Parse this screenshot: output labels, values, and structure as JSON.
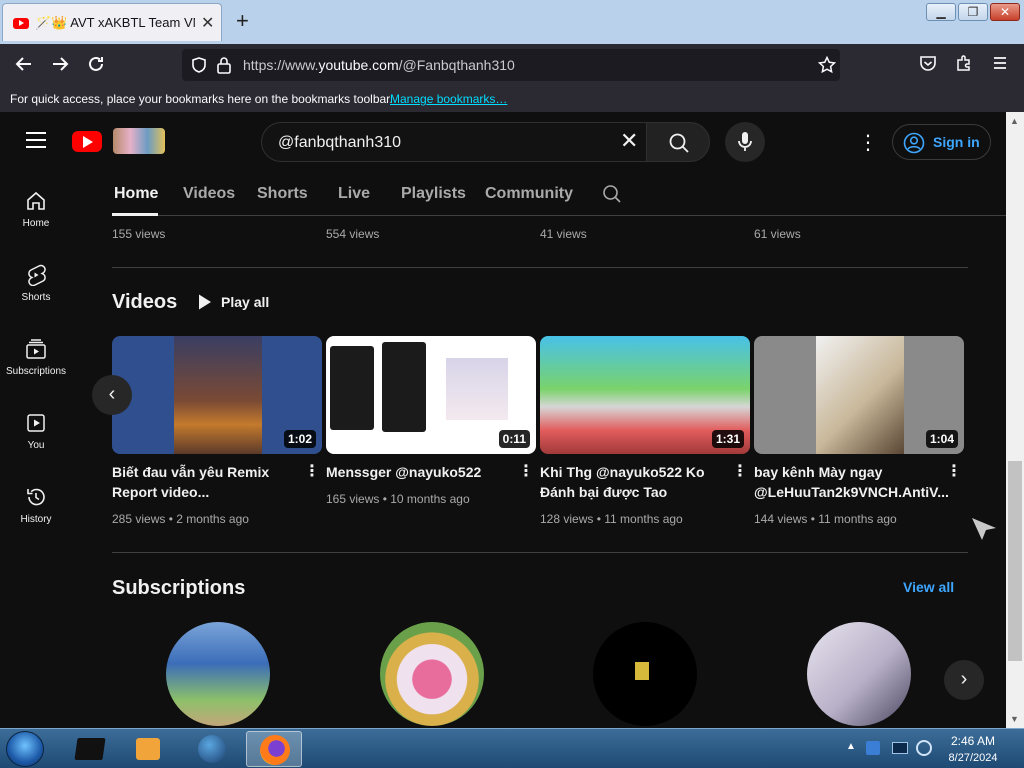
{
  "browser": {
    "tab_title": "🪄👑 AVT xAKBTL Team VNCS -",
    "url_prefix": "https://www.",
    "url_domain": "youtube.com",
    "url_path": "/@Fanbqthanh310",
    "bookmark_text": "For quick access, place your bookmarks here on the bookmarks toolbar.",
    "bookmark_link": "Manage bookmarks…"
  },
  "header": {
    "search_query": "@fanbqthanh310",
    "signin_label": "Sign in"
  },
  "guide": [
    {
      "label": "Home"
    },
    {
      "label": "Shorts"
    },
    {
      "label": "Subscriptions"
    },
    {
      "label": "You"
    },
    {
      "label": "History"
    }
  ],
  "channel_tabs": [
    "Home",
    "Videos",
    "Shorts",
    "Live",
    "Playlists",
    "Community"
  ],
  "shorts_row_views": [
    "155 views",
    "554 views",
    "41 views",
    "61 views"
  ],
  "videos_section": {
    "title": "Videos",
    "play_all": "Play all",
    "items": [
      {
        "title": "Biết đau vẫn yêu Remix Report video...",
        "duration": "1:02",
        "meta": "285 views • 2 months ago"
      },
      {
        "title": "Menssger @nayuko522",
        "duration": "0:11",
        "meta": "165 views • 10 months ago"
      },
      {
        "title": "Khi Thg @nayuko522 Ko Đánh bại được Tao",
        "duration": "1:31",
        "meta": "128 views • 11 months ago"
      },
      {
        "title": "bay kênh Mày ngay @LeHuuTan2k9VNCH.AntiV...",
        "duration": "1:04",
        "meta": "144 views • 11 months ago"
      }
    ]
  },
  "subscriptions": {
    "title": "Subscriptions",
    "view_all": "View all"
  },
  "taskbar": {
    "time": "2:46 AM",
    "date": "8/27/2024"
  }
}
